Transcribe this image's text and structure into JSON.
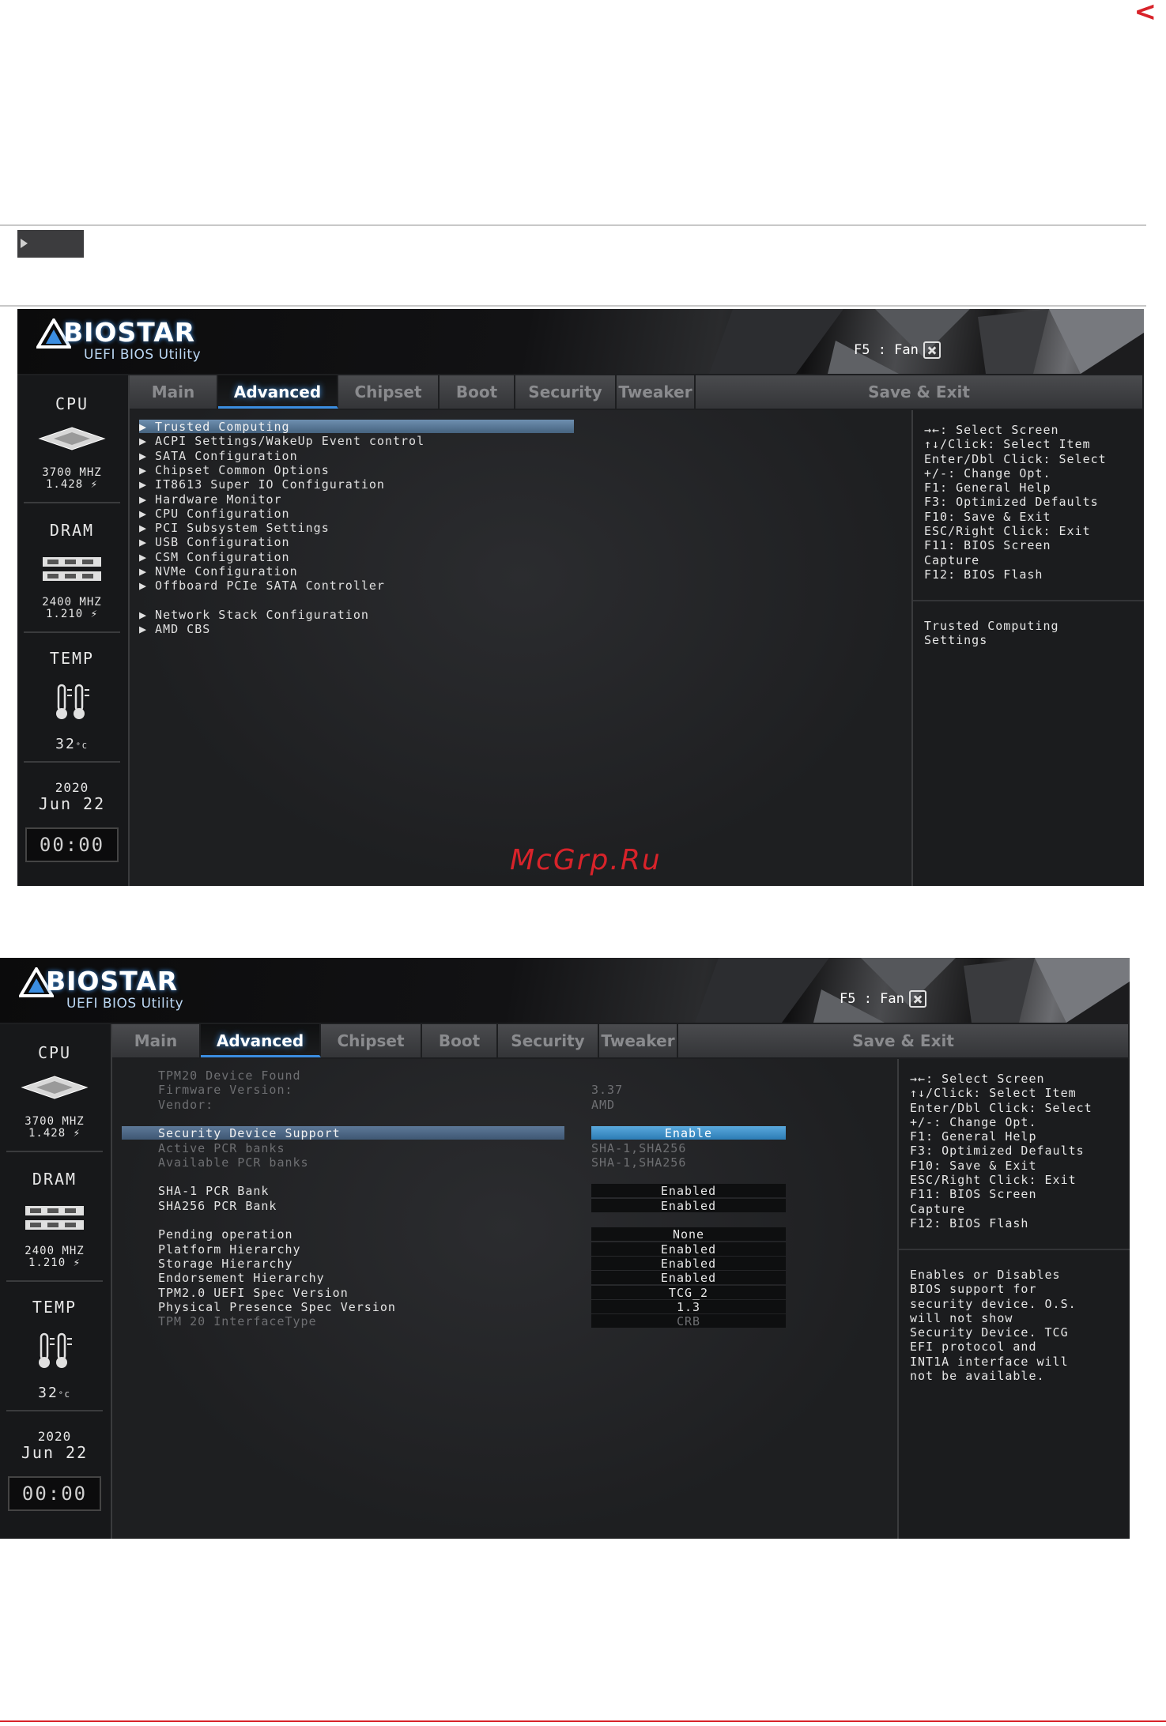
{
  "page_arrow": "<",
  "brand": {
    "logo_text": "BIOSTAR",
    "subtitle": "UEFI BIOS Utility",
    "fan_hint": "F5 : Fan"
  },
  "tabs": [
    "Main",
    "Advanced",
    "Chipset",
    "Boot",
    "Security",
    "Tweaker",
    "Save & Exit"
  ],
  "active_tab": "Advanced",
  "sidebar": {
    "cpu_label": "CPU",
    "cpu_freq": "3700 MHZ",
    "cpu_volt": "1.428",
    "dram_label": "DRAM",
    "dram_freq": "2400 MHZ",
    "dram_volt": "1.210",
    "temp_label": "TEMP",
    "temp_value": "32",
    "year": "2020",
    "date": "Jun 22",
    "clock": "00:00"
  },
  "help_keys": [
    "→←: Select Screen",
    "↑↓/Click: Select Item",
    "Enter/Dbl Click: Select",
    "+/-: Change Opt.",
    "F1: General Help",
    "F3: Optimized Defaults",
    "F10: Save & Exit",
    "ESC/Right Click: Exit",
    "F11: BIOS Screen",
    "Capture",
    "F12: BIOS Flash"
  ],
  "screen1": {
    "menu": [
      "▶ Trusted Computing",
      "▶ ACPI Settings/WakeUp Event control",
      "▶ SATA Configuration",
      "▶ Chipset Common Options",
      "▶ IT8613 Super IO Configuration",
      "▶ Hardware Monitor",
      "▶ CPU Configuration",
      "▶ PCI Subsystem Settings",
      "▶ USB Configuration",
      "▶ CSM Configuration",
      "▶ NVMe Configuration",
      "▶ Offboard PCIe SATA Controller",
      "▶ Network Stack Configuration",
      "▶ AMD CBS"
    ],
    "description": [
      "Trusted Computing",
      "Settings"
    ]
  },
  "screen2": {
    "options": [
      {
        "label": "TPM20 Device Found",
        "value": "",
        "style": "dim"
      },
      {
        "label": "Firmware Version:",
        "value": "3.37",
        "style": "dim"
      },
      {
        "label": "Vendor:",
        "value": "AMD",
        "style": "dim"
      },
      {
        "label": "Security Device Support",
        "value": "Enable",
        "style": "selected"
      },
      {
        "label": "Active PCR banks",
        "value": "SHA-1,SHA256",
        "style": "dim"
      },
      {
        "label": "Available PCR banks",
        "value": "SHA-1,SHA256",
        "style": "dim"
      },
      {
        "label": "SHA-1 PCR Bank",
        "value": "Enabled",
        "style": "box"
      },
      {
        "label": "SHA256 PCR Bank",
        "value": "Enabled",
        "style": "box"
      },
      {
        "label": "Pending operation",
        "value": "None",
        "style": "box"
      },
      {
        "label": "Platform Hierarchy",
        "value": "Enabled",
        "style": "box"
      },
      {
        "label": "Storage Hierarchy",
        "value": "Enabled",
        "style": "box"
      },
      {
        "label": "Endorsement Hierarchy",
        "value": "Enabled",
        "style": "box"
      },
      {
        "label": "TPM2.0 UEFI Spec Version",
        "value": "TCG_2",
        "style": "box"
      },
      {
        "label": "Physical Presence Spec Version",
        "value": "1.3",
        "style": "box"
      },
      {
        "label": "TPM 20 InterfaceType",
        "value": "CRB",
        "style": "dimbox"
      }
    ],
    "description": [
      "Enables or Disables",
      "BIOS support for",
      "security device. O.S.",
      "will not show",
      "Security Device. TCG",
      "EFI protocol and",
      "INT1A interface will",
      "not be available."
    ]
  },
  "watermark": "McGrp.Ru"
}
